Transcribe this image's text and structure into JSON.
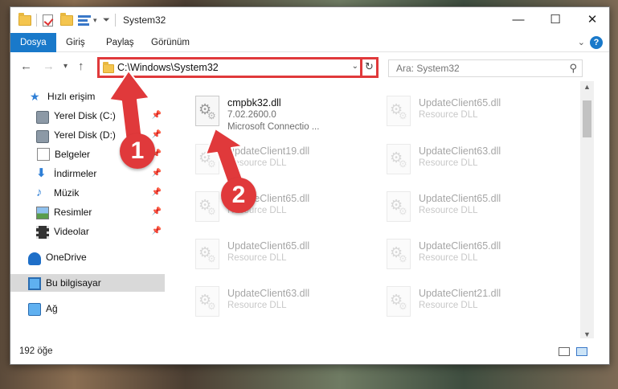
{
  "window": {
    "title": "System32",
    "controls": {
      "minimize": "—",
      "maximize": "☐",
      "close": "✕"
    }
  },
  "ribbon": {
    "tabs": [
      {
        "label": "Dosya"
      },
      {
        "label": "Giriş"
      },
      {
        "label": "Paylaş"
      },
      {
        "label": "Görünüm"
      }
    ],
    "help": "?"
  },
  "navigation": {
    "back": "←",
    "forward": "→",
    "recent": "▾",
    "up": "↑",
    "address": "C:\\Windows\\System32",
    "address_dropdown": "⌄",
    "refresh": "↻",
    "search_placeholder": "Ara: System32",
    "search_icon": "⚲"
  },
  "sidebar": {
    "items": [
      {
        "label": "Hızlı erişim",
        "icon": "star-icon"
      },
      {
        "label": "Yerel Disk (C:)",
        "icon": "disk-icon",
        "pinned": true
      },
      {
        "label": "Yerel Disk (D:)",
        "icon": "disk-icon",
        "pinned": true
      },
      {
        "label": "Belgeler",
        "icon": "document-icon",
        "pinned": true
      },
      {
        "label": "İndirmeler",
        "icon": "download-icon",
        "pinned": true
      },
      {
        "label": "Müzik",
        "icon": "music-icon",
        "pinned": true
      },
      {
        "label": "Resimler",
        "icon": "picture-icon",
        "pinned": true
      },
      {
        "label": "Videolar",
        "icon": "video-icon",
        "pinned": true
      },
      {
        "label": "OneDrive",
        "icon": "cloud-icon"
      },
      {
        "label": "Bu bilgisayar",
        "icon": "computer-icon",
        "selected": true
      },
      {
        "label": "Ağ",
        "icon": "network-icon"
      }
    ],
    "pin_glyph": "📌"
  },
  "files": [
    {
      "name": "cmpbk32.dll",
      "line2": "7.02.2600.0",
      "line3": "Microsoft Connectio ..."
    },
    {
      "name": "UpdateClient65.dll",
      "line2": "Resource DLL"
    },
    {
      "name": "UpdateClient19.dll",
      "line2": "Resource DLL"
    },
    {
      "name": "UpdateClient63.dll",
      "line2": "Resource DLL"
    },
    {
      "name": "UpdateClient65.dll",
      "line2": "Resource DLL"
    },
    {
      "name": "UpdateClient65.dll",
      "line2": "Resource DLL"
    },
    {
      "name": "UpdateClient65.dll",
      "line2": "Resource DLL"
    },
    {
      "name": "UpdateClient65.dll",
      "line2": "Resource DLL"
    },
    {
      "name": "UpdateClient63.dll",
      "line2": "Resource DLL"
    },
    {
      "name": "UpdateClient21.dll",
      "line2": "Resource DLL"
    }
  ],
  "status": {
    "item_count": "192 öğe"
  },
  "annotations": {
    "callout_1": "1",
    "callout_2": "2",
    "accent_color": "#e0393b"
  }
}
